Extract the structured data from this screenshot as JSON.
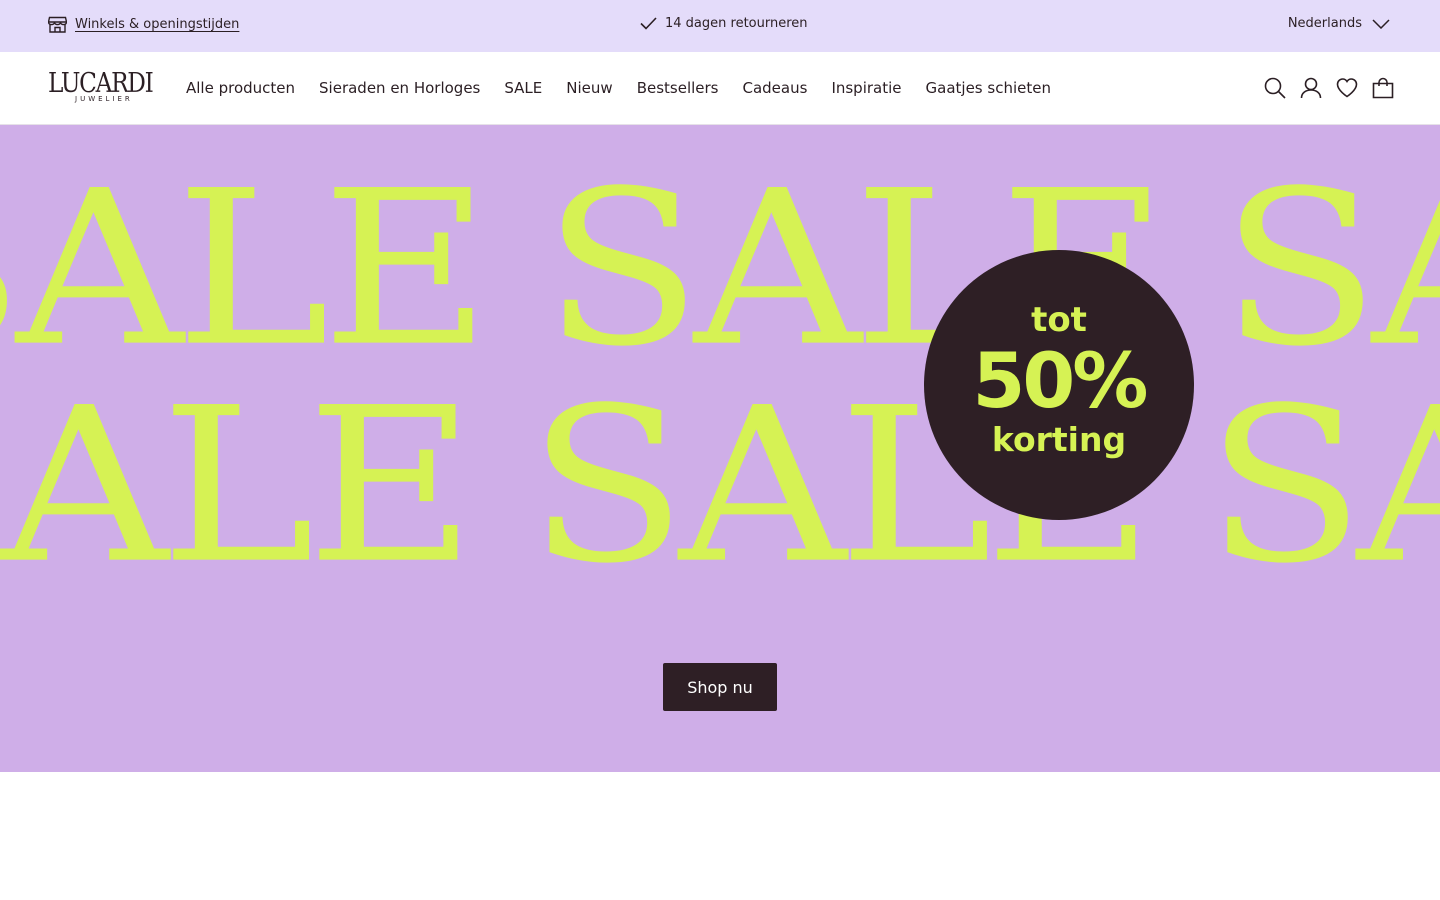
{
  "topbar": {
    "stores_label": "Winkels & openingstijden",
    "usp_label": "14 dagen retourneren",
    "language_label": "Nederlands"
  },
  "header": {
    "logo_text": "LUCARDI",
    "logo_subtext": "JUWELIER",
    "nav": [
      {
        "label": "Alle producten"
      },
      {
        "label": "Sieraden en Horloges"
      },
      {
        "label": "SALE"
      },
      {
        "label": "Nieuw"
      },
      {
        "label": "Bestsellers"
      },
      {
        "label": "Cadeaus"
      },
      {
        "label": "Inspiratie"
      },
      {
        "label": "Gaatjes schieten"
      }
    ],
    "icons": [
      "search-icon",
      "account-icon",
      "wishlist-icon",
      "bag-icon"
    ]
  },
  "hero": {
    "sale_word": "SALE",
    "badge": {
      "top": "tot",
      "middle": "50%",
      "bottom": "korting"
    },
    "cta_label": "Shop nu"
  },
  "colors": {
    "topbar_bg": "#e4dcfa",
    "hero_bg": "#cfaee8",
    "accent_lime": "#d6f254",
    "dark": "#2e1f25"
  }
}
